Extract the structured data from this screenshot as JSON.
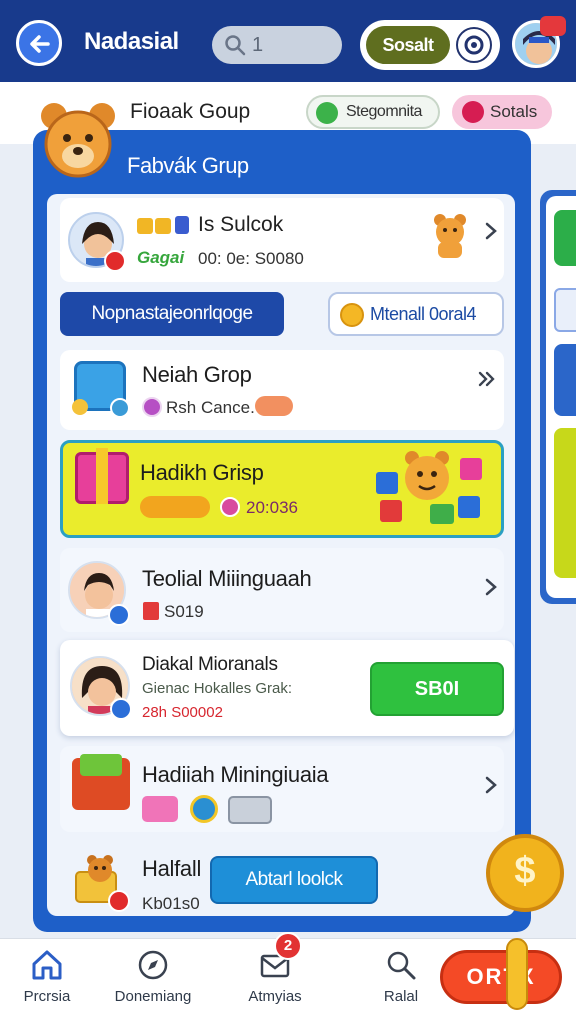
{
  "header": {
    "title": "Nadasial",
    "search_value": "1",
    "toggle_label": "Sosalt"
  },
  "group_strip": {
    "title": "Fioaak Goup",
    "chip_green": "Stegomnita",
    "chip_pink": "Sotals"
  },
  "panel": {
    "title": "Fabvák Grup"
  },
  "profile": {
    "name": "Is Sulcok",
    "tag": "Gagai",
    "time": "00: 0e: S0080"
  },
  "actions": {
    "primary": "Nopnastajeonrlqoge",
    "secondary": "Mtenall 0oral4"
  },
  "rows": [
    {
      "title": "Neiah Grop",
      "sub": "Rsh Cance."
    },
    {
      "title": "Hadikh Grisp",
      "sub": "20:036"
    },
    {
      "title": "Teolial Miiinguaah",
      "sub": "S019"
    },
    {
      "title": "Hadiiah Miningiuaia"
    },
    {
      "title": "Halfall",
      "sub": "Kb01s0"
    }
  ],
  "invite": {
    "title": "Diakal Mioranals",
    "subtitle": "Gienac Hokalles Grak:",
    "code": "28h S00002",
    "button": "SB0I"
  },
  "bottom_button": "Abtarl loolck",
  "nav": {
    "items": [
      {
        "label": "Prcrsia",
        "icon": "home-icon"
      },
      {
        "label": "Donemiang",
        "icon": "compass-icon"
      },
      {
        "label": "Atmyias",
        "icon": "mail-icon",
        "badge": "2"
      },
      {
        "label": "Ralal",
        "icon": "search-person-icon"
      }
    ],
    "cta_label": "ORTX"
  },
  "colors": {
    "header_bg": "#183a8c",
    "panel_blue": "#1e5fc8",
    "highlight_yellow": "#eaec2c",
    "green_button": "#2fc13f",
    "cta_orange": "#f44a26"
  }
}
